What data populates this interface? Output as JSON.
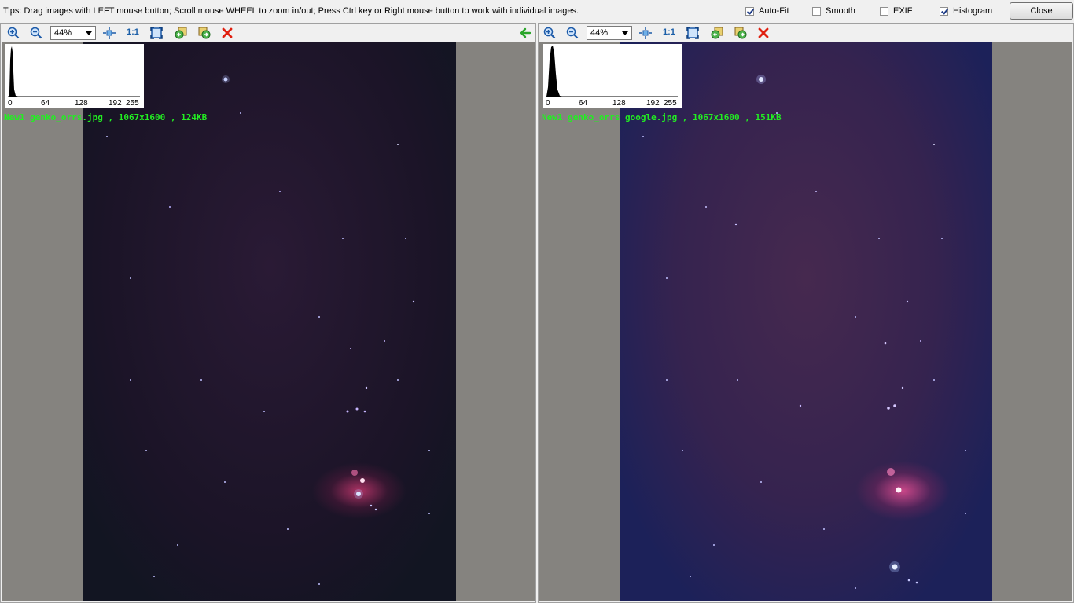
{
  "tips": "Tips: Drag images with LEFT mouse button; Scroll mouse WHEEL to zoom in/out; Press Ctrl key or Right mouse button to work with individual images.",
  "options": [
    {
      "label": "Auto-Fit",
      "checked": true
    },
    {
      "label": "Smooth",
      "checked": false
    },
    {
      "label": "EXIF",
      "checked": false
    },
    {
      "label": "Histogram",
      "checked": true
    }
  ],
  "close_label": "Close",
  "panes": [
    {
      "zoom": "44%",
      "one_to_one": "1:1",
      "caption": "New1 genko_orrs.jpg  , 1067x1600  , 124KB",
      "hist_labels": [
        "0",
        "64",
        "128",
        "192",
        "255"
      ]
    },
    {
      "zoom": "44%",
      "one_to_one": "1:1",
      "caption": "New1 genko_orrs google.jpg  , 1067x1600  , 151KB",
      "hist_labels": [
        "0",
        "64",
        "128",
        "192",
        "255"
      ]
    }
  ],
  "icons": {
    "zoom_in": "zoom-in-icon",
    "zoom_out": "zoom-out-icon",
    "fit": "fit-center-icon",
    "fullscreen": "fit-window-icon",
    "prev": "previous-image-icon",
    "next": "next-image-icon",
    "delete": "delete-icon",
    "sync": "sync-arrow-icon"
  },
  "colors": {
    "caption": "#22ee22",
    "viewport_bg": "#85837f",
    "delete": "#e02010",
    "sync_arrow": "#2aa52a"
  }
}
